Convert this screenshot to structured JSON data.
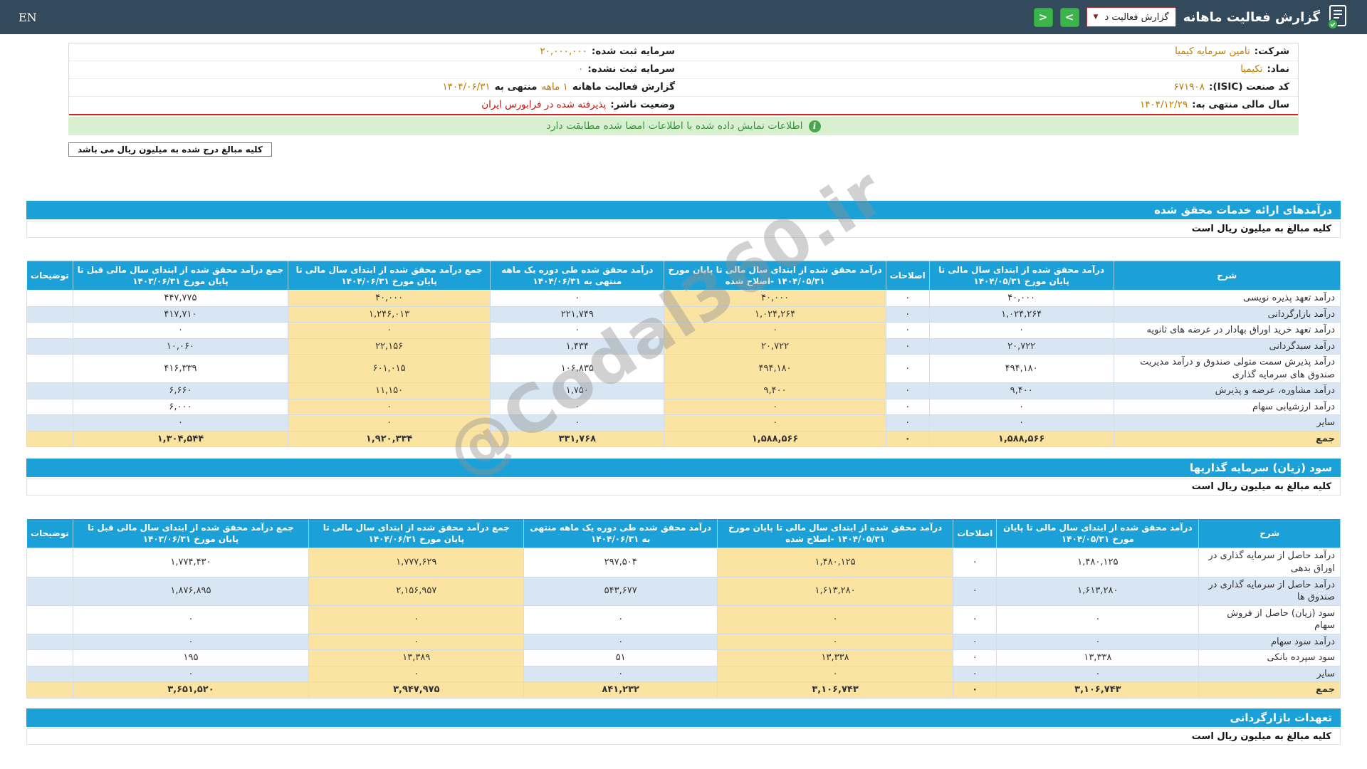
{
  "topbar": {
    "lang": "EN",
    "title": "گزارش فعالیت ماهانه",
    "dropdown_label": "گزارش فعالیت د",
    "prev_arrow": "<",
    "next_arrow": ">"
  },
  "company": {
    "right_rows": [
      {
        "label": "شرکت:",
        "value": "تامین سرمایه کیمیا"
      },
      {
        "label": "نماد:",
        "value": "تکیمیا"
      },
      {
        "label": "کد صنعت (ISIC):",
        "value": "۶۷۱۹۰۸"
      },
      {
        "label": "سال مالی منتهی به:",
        "value": "۱۴۰۴/۱۲/۲۹"
      }
    ],
    "left_rows": [
      {
        "label": "سرمایه ثبت شده:",
        "value": "۲۰,۰۰۰,۰۰۰"
      },
      {
        "label": "سرمایه ثبت نشده:",
        "value": "۰"
      },
      {
        "label": "گزارش فعالیت ماهانه",
        "highlight": "۱ ماهه",
        "label2": "منتهی به",
        "value": "۱۴۰۴/۰۶/۳۱"
      },
      {
        "label": "وضعیت ناشر:",
        "value": "پذیرفته شده در فرابورس ایران"
      }
    ]
  },
  "banner": {
    "text": "اطلاعات نمایش داده شده با اطلاعات امضا شده مطابقت دارد"
  },
  "note": {
    "text": "کلیه مبالغ درج شده به میلیون ریال می باشد"
  },
  "unit_note": "کلیه مبالغ به میلیون ریال است",
  "table1": {
    "title": "درآمدهای ارائه خدمات محقق شده",
    "headers": [
      "شرح",
      "درآمد محقق شده از ابتدای سال مالی تا پایان مورخ ۱۴۰۴/۰۵/۳۱",
      "اصلاحات",
      "درآمد محقق شده از ابتدای سال مالی تا پایان مورخ ۱۴۰۴/۰۵/۳۱ -اصلاح شده",
      "درآمد محقق شده طی دوره یک ماهه منتهی به ۱۴۰۴/۰۶/۳۱",
      "جمع درآمد محقق شده از ابتدای سال مالی تا پایان مورخ ۱۴۰۴/۰۶/۳۱",
      "جمع درآمد محقق شده از ابتدای سال مالی قبل تا پایان مورخ ۱۴۰۳/۰۶/۳۱",
      "توضیحات"
    ],
    "rows": [
      {
        "total": false,
        "cells": [
          "درآمد تعهد پذیره نویسی",
          "۴۰,۰۰۰",
          "۰",
          "۴۰,۰۰۰",
          "۰",
          "۴۰,۰۰۰",
          "۴۴۷,۷۷۵",
          ""
        ]
      },
      {
        "total": false,
        "cells": [
          "درآمد بازارگردانی",
          "۱,۰۲۴,۲۶۴",
          "۰",
          "۱,۰۲۴,۲۶۴",
          "۲۲۱,۷۴۹",
          "۱,۲۴۶,۰۱۳",
          "۴۱۷,۷۱۰",
          ""
        ]
      },
      {
        "total": false,
        "cells": [
          "درآمد تعهد خرید اوراق بهادار در عرضه های ثانویه",
          "۰",
          "۰",
          "۰",
          "۰",
          "۰",
          "۰",
          ""
        ]
      },
      {
        "total": false,
        "cells": [
          "درآمد سبدگردانی",
          "۲۰,۷۲۲",
          "۰",
          "۲۰,۷۲۲",
          "۱,۴۳۴",
          "۲۲,۱۵۶",
          "۱۰,۰۶۰",
          ""
        ]
      },
      {
        "total": false,
        "cells": [
          "درآمد پذیرش سمت متولی صندوق و درآمد مدیریت صندوق های سرمایه گذاری",
          "۴۹۴,۱۸۰",
          "۰",
          "۴۹۴,۱۸۰",
          "۱۰۶,۸۳۵",
          "۶۰۱,۰۱۵",
          "۴۱۶,۳۳۹",
          ""
        ]
      },
      {
        "total": false,
        "cells": [
          "درآمد مشاوره، عرضه و پذیرش",
          "۹,۴۰۰",
          "۰",
          "۹,۴۰۰",
          "۱,۷۵۰",
          "۱۱,۱۵۰",
          "۶,۶۶۰",
          ""
        ]
      },
      {
        "total": false,
        "cells": [
          "درآمد ارزشیابی سهام",
          "۰",
          "۰",
          "۰",
          "۰",
          "۰",
          "۶,۰۰۰",
          ""
        ]
      },
      {
        "total": false,
        "cells": [
          "سایر",
          "۰",
          "۰",
          "۰",
          "۰",
          "۰",
          "۰",
          ""
        ]
      },
      {
        "total": true,
        "cells": [
          "جمع",
          "۱,۵۸۸,۵۶۶",
          "۰",
          "۱,۵۸۸,۵۶۶",
          "۳۳۱,۷۶۸",
          "۱,۹۲۰,۳۳۴",
          "۱,۳۰۴,۵۴۴",
          ""
        ]
      }
    ]
  },
  "table2": {
    "title": "سود (زیان) سرمایه گذاریها",
    "headers": [
      "شرح",
      "درآمد محقق شده از ابتدای سال مالی تا پایان مورخ ۱۴۰۴/۰۵/۳۱",
      "اصلاحات",
      "درآمد محقق شده از ابتدای سال مالی تا پایان مورخ ۱۴۰۴/۰۵/۳۱ -اصلاح شده",
      "درآمد محقق شده طی دوره یک ماهه منتهی به ۱۴۰۴/۰۶/۳۱",
      "جمع درآمد محقق شده از ابتدای سال مالی تا پایان مورخ ۱۴۰۴/۰۶/۳۱",
      "جمع درآمد محقق شده از ابتدای سال مالی قبل تا پایان مورخ ۱۴۰۳/۰۶/۳۱",
      "توضیحات"
    ],
    "rows": [
      {
        "total": false,
        "cells": [
          "درآمد حاصل از سرمایه گذاری در اوراق بدهی",
          "۱,۴۸۰,۱۲۵",
          "۰",
          "۱,۴۸۰,۱۲۵",
          "۲۹۷,۵۰۴",
          "۱,۷۷۷,۶۲۹",
          "۱,۷۷۴,۴۳۰",
          ""
        ]
      },
      {
        "total": false,
        "cells": [
          "درآمد حاصل از سرمایه گذاری در صندوق ها",
          "۱,۶۱۳,۲۸۰",
          "۰",
          "۱,۶۱۳,۲۸۰",
          "۵۴۳,۶۷۷",
          "۲,۱۵۶,۹۵۷",
          "۱,۸۷۶,۸۹۵",
          ""
        ]
      },
      {
        "total": false,
        "cells": [
          "سود (زیان) حاصل از فروش سهام",
          "۰",
          "۰",
          "۰",
          "۰",
          "۰",
          "۰",
          ""
        ]
      },
      {
        "total": false,
        "cells": [
          "درآمد سود سهام",
          "۰",
          "۰",
          "۰",
          "۰",
          "۰",
          "۰",
          ""
        ]
      },
      {
        "total": false,
        "cells": [
          "سود سپرده بانکی",
          "۱۳,۳۳۸",
          "۰",
          "۱۳,۳۳۸",
          "۵۱",
          "۱۳,۳۸۹",
          "۱۹۵",
          ""
        ]
      },
      {
        "total": false,
        "cells": [
          "سایر",
          "۰",
          "۰",
          "۰",
          "۰",
          "۰",
          "۰",
          ""
        ]
      },
      {
        "total": true,
        "cells": [
          "جمع",
          "۳,۱۰۶,۷۴۳",
          "۰",
          "۳,۱۰۶,۷۴۳",
          "۸۴۱,۲۳۲",
          "۳,۹۴۷,۹۷۵",
          "۳,۶۵۱,۵۲۰",
          ""
        ]
      }
    ]
  },
  "section3": {
    "title": "تعهدات بازارگردانی"
  },
  "watermark": {
    "text": "@Codal360.ir"
  },
  "colors": {
    "topbar": "#33495c",
    "accent_blue": "#1ba1d8",
    "beige_column": "#fbe3a2",
    "alt_row_blue": "#d8e6f3",
    "button_green": "#3bb54a",
    "value_orange": "#c07a00",
    "alert_red": "#cc1111",
    "banner_green_bg": "#d8efd0"
  }
}
